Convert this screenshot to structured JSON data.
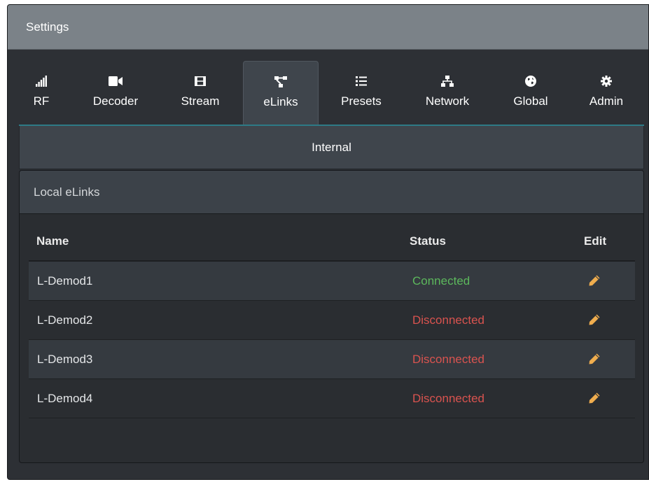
{
  "title": "Settings",
  "tabs": [
    {
      "label": "RF",
      "icon": "signal-bars-icon",
      "active": false
    },
    {
      "label": "Decoder",
      "icon": "video-camera-icon",
      "active": false
    },
    {
      "label": "Stream",
      "icon": "film-icon",
      "active": false
    },
    {
      "label": "eLinks",
      "icon": "sitemap-icon",
      "active": true
    },
    {
      "label": "Presets",
      "icon": "list-icon",
      "active": false
    },
    {
      "label": "Network",
      "icon": "network-icon",
      "active": false
    },
    {
      "label": "Global",
      "icon": "globe-icon",
      "active": false
    },
    {
      "label": "Admin",
      "icon": "cog-icon",
      "active": false
    }
  ],
  "section_header": "Internal",
  "panel": {
    "heading": "Local eLinks",
    "columns": {
      "name": "Name",
      "status": "Status",
      "edit": "Edit"
    },
    "rows": [
      {
        "name": "L-Demod1",
        "status": "Connected"
      },
      {
        "name": "L-Demod2",
        "status": "Disconnected"
      },
      {
        "name": "L-Demod3",
        "status": "Disconnected"
      },
      {
        "name": "L-Demod4",
        "status": "Disconnected"
      }
    ]
  },
  "colors": {
    "connected": "#5cb85c",
    "disconnected": "#d9534f",
    "edit_icon": "#f0ad4e",
    "accent_underline": "#2d7a86"
  }
}
